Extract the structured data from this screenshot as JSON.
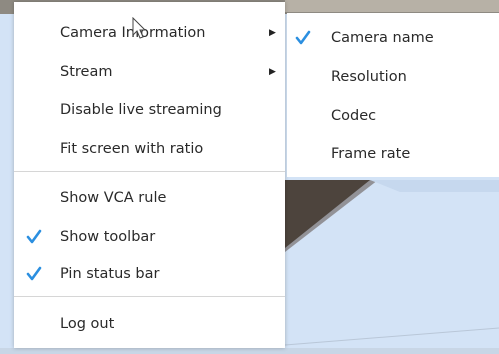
{
  "menu": {
    "items": [
      {
        "label": "Camera Information",
        "submenu": true
      },
      {
        "label": "Stream",
        "submenu": true
      },
      {
        "label": "Disable live streaming"
      },
      {
        "label": "Fit screen with ratio"
      },
      {
        "label": "Show VCA rule"
      },
      {
        "label": "Show toolbar",
        "checked": true
      },
      {
        "label": "Pin status bar",
        "checked": true
      },
      {
        "label": "Log out"
      }
    ]
  },
  "submenu": {
    "items": [
      {
        "label": "Camera name",
        "checked": true
      },
      {
        "label": "Resolution"
      },
      {
        "label": "Codec"
      },
      {
        "label": "Frame rate"
      }
    ]
  },
  "colors": {
    "accent": "#2b8fe0",
    "menu_background": "#ffffff",
    "sky": "#d3e3f6",
    "roof": "#3a3530"
  },
  "icons": {
    "check": "check-icon",
    "submenu_arrow": "caret-right-icon",
    "cursor": "mouse-pointer-icon"
  }
}
